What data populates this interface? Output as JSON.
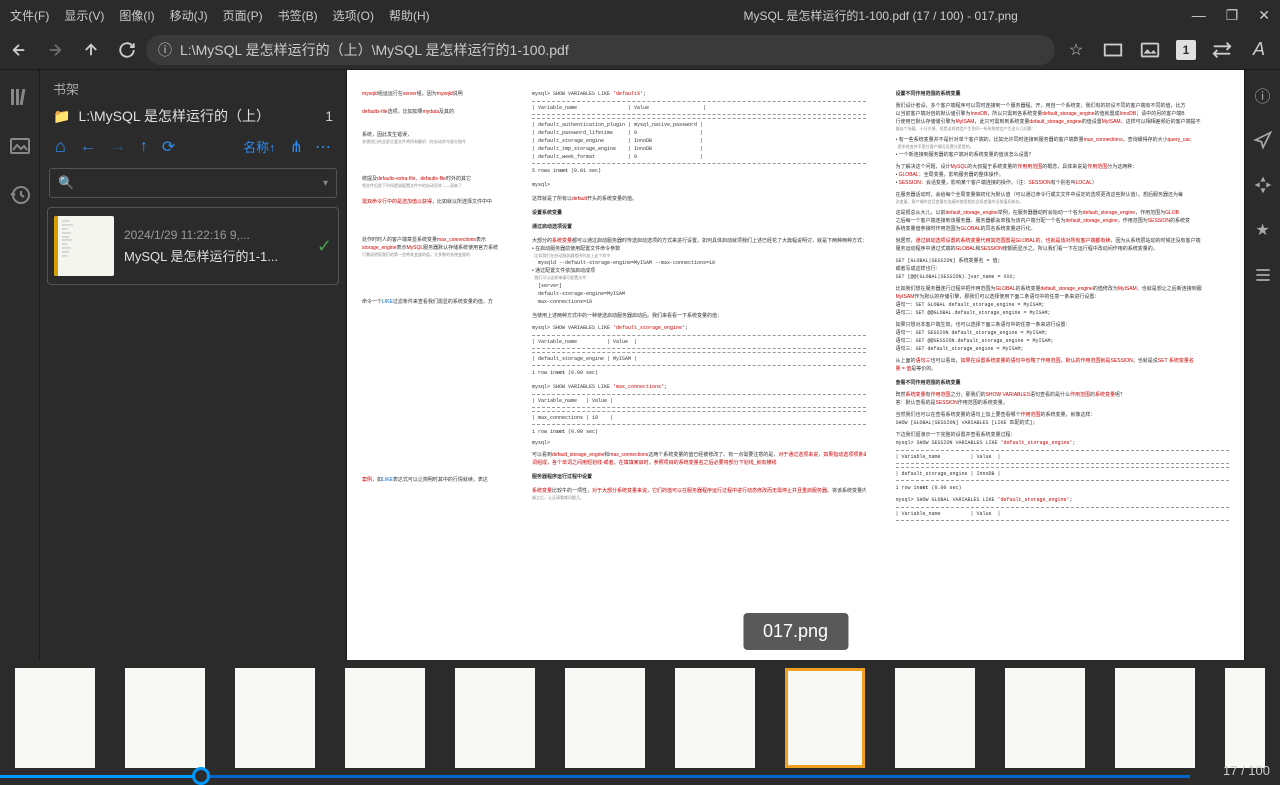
{
  "menubar": {
    "items": [
      "文件(F)",
      "显示(V)",
      "图像(I)",
      "移动(J)",
      "页面(P)",
      "书签(B)",
      "选项(O)",
      "帮助(H)"
    ],
    "title": "MySQL 是怎样运行的1-100.pdf (17 / 100) - 017.png"
  },
  "toolbar": {
    "address": "L:\\MySQL 是怎样运行的（上）\\MySQL 是怎样运行的1-100.pdf",
    "page_badge": "1"
  },
  "sidebar": {
    "header": "书架",
    "folder_path": "L:\\MySQL 是怎样运行的（上）",
    "folder_count": "1",
    "sort_label": "名称↑",
    "items": [
      {
        "meta": "2024/1/29 11:22:16   9,...",
        "name": "MySQL 是怎样运行的1-1..."
      }
    ]
  },
  "doc": {
    "tooltip": "017.png"
  },
  "thumbnails": {
    "count": 12,
    "active_index": 7
  },
  "bottom": {
    "page_indicator": "17 / 100"
  }
}
